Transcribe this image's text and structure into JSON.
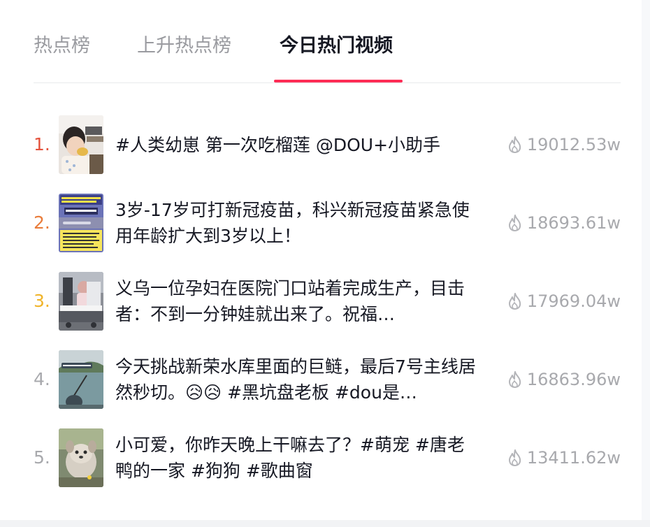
{
  "tabs": [
    {
      "label": "热点榜",
      "active": false
    },
    {
      "label": "上升热点榜",
      "active": false
    },
    {
      "label": "今日热门视频",
      "active": true
    }
  ],
  "accent_color": "#fe2c55",
  "items": [
    {
      "rank": "1.",
      "rank_color": "#e4533d",
      "title": "#人类幼崽 第一次吃榴莲 @DOU+小助手",
      "heat": "19012.53w",
      "thumb_icon": "toddler-eating-durian-thumbnail"
    },
    {
      "rank": "2.",
      "rank_color": "#e97d3c",
      "title": "3岁-17岁可打新冠疫苗，科兴新冠疫苗紧急使用年龄扩大到3岁以上！",
      "heat": "18693.61w",
      "thumb_icon": "vaccine-news-thumbnail"
    },
    {
      "rank": "3.",
      "rank_color": "#f0b429",
      "title": "义乌一位孕妇在医院门口站着完成生产，目击者：不到一分钟娃就出来了。祝福…",
      "heat": "17969.04w",
      "thumb_icon": "hospital-birth-thumbnail"
    },
    {
      "rank": "4.",
      "rank_color": "#a8a9ad",
      "title": "今天挑战新荣水库里面的巨鲢，最后7号主线居然秒切。😥😥 #黑坑盘老板 #dou是…",
      "heat": "16863.96w",
      "thumb_icon": "fishing-reservoir-thumbnail"
    },
    {
      "rank": "5.",
      "rank_color": "#a8a9ad",
      "title": "小可爱，你昨天晚上干嘛去了？#萌宠 #唐老鸭的一家 #狗狗 #歌曲窗",
      "heat": "13411.62w",
      "thumb_icon": "cute-puppy-thumbnail"
    }
  ]
}
